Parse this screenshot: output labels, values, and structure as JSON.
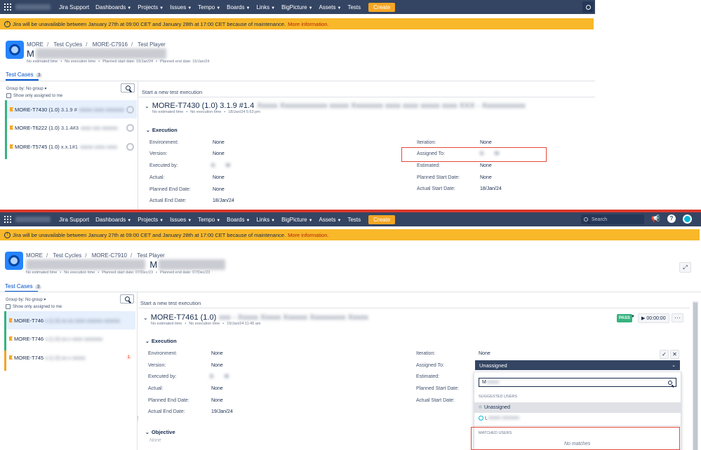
{
  "nav": {
    "items": [
      "Jira Support",
      "Dashboards",
      "Projects",
      "Issues",
      "Tempo",
      "Boards",
      "Links",
      "BigPicture",
      "Assets",
      "Tests"
    ],
    "dropdown_items": [
      "Dashboards",
      "Projects",
      "Issues",
      "Tempo",
      "Boards",
      "Links",
      "BigPicture",
      "Assets"
    ],
    "create_label": "Create",
    "search_placeholder": "Search"
  },
  "banner": {
    "text": "Jira will be unavailable between January 27th at 09:00 CET and January 28th at 17:00 CET because of maintenance.",
    "link": "More information."
  },
  "panel1": {
    "breadcrumb": [
      "MORE",
      "Test Cycles",
      "MORE-C7916",
      "Test Player"
    ],
    "title_initial": "M",
    "meta": [
      "No estimated time",
      "No execution time",
      "Planned start date: 15/Jan/24",
      "Planned end date: 15/Jan/24"
    ],
    "tab_label": "Test Cases",
    "tab_count": "3",
    "group_by": "Group by: No group",
    "show_only": "Show only assigned to me",
    "test_cases": [
      {
        "key": "MORE-T7430 (1.0)",
        "version": "3.1.9 #"
      },
      {
        "key": "MORE-T6222 (1.0)",
        "version": "3.1.4#3"
      },
      {
        "key": "MORE-T5745 (1.0)",
        "version": "x.x.1#1"
      }
    ],
    "start_new": "Start a new test execution",
    "exec_title": "MORE-T7430 (1.0) 3.1.9 #1.4",
    "exec_meta": [
      "No estimated time",
      "No execution time",
      "18/Jan/24 5:53 pm"
    ],
    "section": "Execution",
    "left_fields": [
      {
        "label": "Environment:",
        "value": "None"
      },
      {
        "label": "Version:",
        "value": "None"
      },
      {
        "label": "Executed by:",
        "value": "G        M"
      },
      {
        "label": "Actual:",
        "value": "None"
      },
      {
        "label": "Planned End Date:",
        "value": "None"
      },
      {
        "label": "Actual End Date:",
        "value": "18/Jan/24"
      }
    ],
    "right_fields": [
      {
        "label": "Iteration:",
        "value": "None"
      },
      {
        "label": "Assigned To:",
        "value": "G        M"
      },
      {
        "label": "Estimated:",
        "value": "None"
      },
      {
        "label": "Planned Start Date:",
        "value": "None"
      },
      {
        "label": "Actual Start Date:",
        "value": "18/Jan/24"
      }
    ]
  },
  "panel2": {
    "breadcrumb": [
      "MORE",
      "Test Cycles",
      "MORE-C7910",
      "Test Player"
    ],
    "title_initial": "M",
    "meta": [
      "No estimated time",
      "No execution time",
      "Planned start date: 07/Dec/23",
      "Planned end date: 07/Dec/23"
    ],
    "tab_label": "Test Cases",
    "tab_count": "3",
    "group_by": "Group by: No group",
    "show_only": "Show only assigned to me",
    "test_cases": [
      {
        "key": "MORE-T746",
        "badge": ""
      },
      {
        "key": "MORE-T746",
        "badge": ""
      },
      {
        "key": "MORE-T745",
        "badge": "1"
      }
    ],
    "start_new": "Start a new test execution",
    "exec_title": "MORE-T7461 (1.0)",
    "exec_meta": [
      "No estimated time",
      "No execution time",
      "19/Jan/24 11:45 am"
    ],
    "pass_label": "PASS",
    "timer": "00:00:00",
    "section": "Execution",
    "section2": "Objective",
    "objective_value": "None",
    "left_fields": [
      {
        "label": "Environment:",
        "value": "None"
      },
      {
        "label": "Version:",
        "value": "None"
      },
      {
        "label": "Executed by:",
        "value": "G        M"
      },
      {
        "label": "Actual:",
        "value": "None"
      },
      {
        "label": "Planned End Date:",
        "value": "None"
      },
      {
        "label": "Actual End Date:",
        "value": "19/Jan/24"
      }
    ],
    "right_fields": [
      {
        "label": "Iteration:",
        "value": "None"
      },
      {
        "label": "Assigned To:",
        "value": ""
      },
      {
        "label": "Estimated:",
        "value": ""
      },
      {
        "label": "Planned Start Date:",
        "value": ""
      },
      {
        "label": "Actual Start Date:",
        "value": ""
      }
    ],
    "assignee_dropdown": "Unassigned",
    "picker": {
      "input_value": "M",
      "suggested_header": "SUGGESTED USERS",
      "unassigned": "Unassigned",
      "user_initial": "L",
      "matched_header": "MATCHED USERS",
      "no_matches": "No matches"
    }
  },
  "colors": {
    "nav_bg": "#344563",
    "banner": "#f8b82a",
    "create": "#f5a623",
    "highlight": "#e5493a",
    "pass": "#36b37e"
  }
}
